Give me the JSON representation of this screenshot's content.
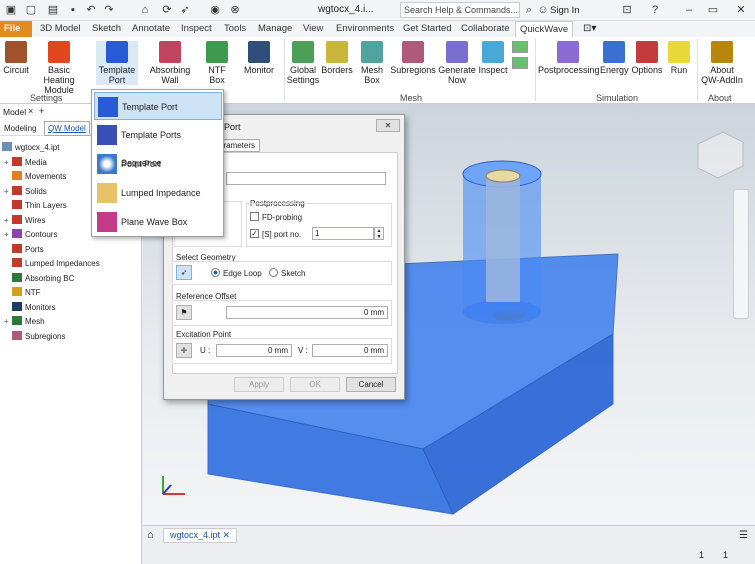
{
  "window": {
    "title": "wgtocx_4.i...",
    "search_placeholder": "Search Help & Commands...",
    "signin": "Sign In"
  },
  "tabs": [
    "File",
    "3D Model",
    "Sketch",
    "Annotate",
    "Inspect",
    "Tools",
    "Manage",
    "View",
    "Environments",
    "Get Started",
    "Collaborate",
    "QuickWave"
  ],
  "ribbon": {
    "buttons": [
      "Circuit",
      "Basic Heating Module",
      "Template Port",
      "Absorbing Wall",
      "NTF Box",
      "Monitor",
      "Global Settings",
      "Borders",
      "Mesh Box",
      "Subregions",
      "Generate Now",
      "Inspect",
      "Postprocessing",
      "Energy",
      "Options",
      "Run",
      "About QW-AddIn"
    ],
    "groups": [
      "Settings",
      "Mesh",
      "Simulation",
      "About"
    ]
  },
  "left_panel": {
    "tab_model": "Model",
    "tab_modeling": "Modeling",
    "tab_qw": "QW Model",
    "tree": [
      {
        "label": "wgtocx_4.ipt",
        "exp": ""
      },
      {
        "label": "Media",
        "exp": "+"
      },
      {
        "label": "Movements",
        "exp": ""
      },
      {
        "label": "Solids",
        "exp": "+"
      },
      {
        "label": "Thin Layers",
        "exp": ""
      },
      {
        "label": "Wires",
        "exp": "+"
      },
      {
        "label": "Contours",
        "exp": "+"
      },
      {
        "label": "Ports",
        "exp": ""
      },
      {
        "label": "Lumped Impedances",
        "exp": ""
      },
      {
        "label": "Absorbing BC",
        "exp": ""
      },
      {
        "label": "NTF",
        "exp": ""
      },
      {
        "label": "Monitors",
        "exp": ""
      },
      {
        "label": "Mesh",
        "exp": "+"
      },
      {
        "label": "Subregions",
        "exp": ""
      }
    ]
  },
  "dropdown": {
    "items": [
      "Template Port",
      "Template Ports Sequence",
      "Point Port",
      "Lumped Impedance",
      "Plane Wave Box"
    ]
  },
  "dialog": {
    "title": "te Port",
    "tab": "arameters",
    "postprocessing_label": "Postprocessing",
    "fd_probing": "FD-probing",
    "port_no_label": "[S] port no.",
    "port_no_value": "1",
    "select_geometry": "Select Geometry",
    "edge_loop": "Edge Loop",
    "sketch": "Sketch",
    "reference_offset": "Reference Offset",
    "offset_value": "0 mm",
    "excitation_point": "Excitation Point",
    "u_label": "U :",
    "u_value": "0 mm",
    "v_label": "V :",
    "v_value": "0 mm",
    "apply": "Apply",
    "ok": "OK",
    "cancel": "Cancel",
    "close": "✕"
  },
  "doc_tab": "wgtocx_4.ipt",
  "status": {
    "a": "1",
    "b": "1"
  },
  "colors": {
    "accent": "#e38c1d",
    "solid": "#3c7ef0",
    "highlight": "#cfe3f7"
  }
}
